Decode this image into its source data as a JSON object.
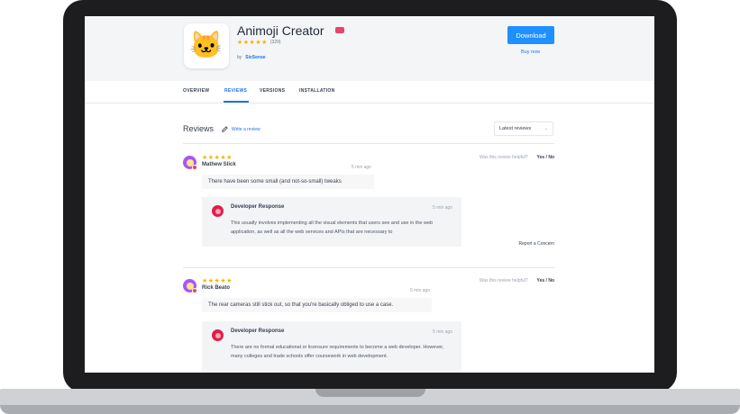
{
  "app": {
    "title": "Animoji Creator",
    "stars": "★★★★★",
    "rating_count": "(329)",
    "by": "by",
    "author": "SixSense",
    "download_label": "Download",
    "buy_now_label": "Buy now",
    "icon_emoji": "🐱",
    "badge_color": "#e8446b"
  },
  "tabs": [
    "OVERVIEW",
    "REVIEWS",
    "VERSIONS",
    "INSTALLATION"
  ],
  "active_tab": "REVIEWS",
  "reviews_section": {
    "title": "Reviews",
    "write_review_label": "Write a review",
    "sort_selected": "Latest reviews"
  },
  "reviews": [
    {
      "stars": "★★★★★",
      "name": "Mathew Slick",
      "time": "5 min ago",
      "helpful_question": "Was this review helpful?",
      "helpful_options": "Yes / No",
      "comment": "There have been some small (and not-so-small) tweaks",
      "developer_response": {
        "title": "Developer Response",
        "time": "5 min ago",
        "text": "This usually involves implementing all the visual elements that users see and use in the web application, as well as all the web services and APIs that are necessary to"
      },
      "report_label": "Report a Concern"
    },
    {
      "stars": "★★★★★",
      "name": "Rick Beato",
      "time": "5 min ago",
      "helpful_question": "Was this review helpful?",
      "helpful_options": "Yes / No",
      "comment": "The rear cameras still stick out, so that you're basically obliged to use a case.",
      "developer_response": {
        "title": "Developer Response",
        "time": "5 min ago",
        "text": "There are no formal educational or licensure requirements to become a web developer. However, many colleges and trade schools offer coursework in web development."
      }
    }
  ],
  "colors": {
    "accent": "#1e90ff",
    "link": "#1a73e8",
    "star": "#f5b400",
    "frame": "#1d1d1f"
  }
}
